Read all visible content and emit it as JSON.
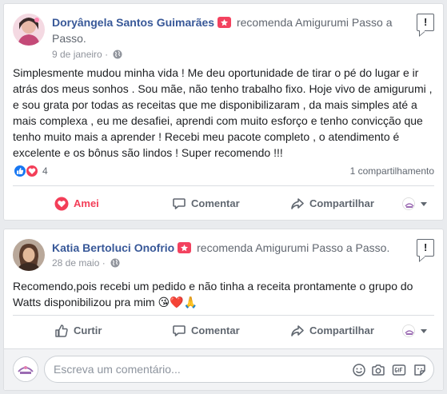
{
  "colors": {
    "link": "#385898",
    "love": "#f33e58",
    "recommend": "#f3425f",
    "muted": "#606770"
  },
  "posts": [
    {
      "author": "Doryângela Santos Guimarães",
      "verb": "recomenda Amigurumi Passo a",
      "verb_cont": "Passo.",
      "date": "9 de janeiro",
      "dot": "·",
      "text": "Simplesmente mudou minha vida ! Me deu oportunidade de tirar o pé do lugar e ir atrás dos meus sonhos . Sou mãe, não tenho trabalho fixo. Hoje vivo de amigurumi , e sou grata por todas as receitas que me disponibilizaram , da mais simples até a mais complexa , eu me desafiei, aprendi com muito esforço e tenho convicção que tenho muito mais a aprender ! Recebi meu pacote completo , o atendimento é excelente e os bônus são lindos ! Super recomendo !!!",
      "reaction_count": "4",
      "shares": "1 compartilhamento",
      "like_label": "Amei",
      "comment_label": "Comentar",
      "share_label": "Compartilhar",
      "flag": "!"
    },
    {
      "author": "Katia Bertoluci Onofrio",
      "verb": "recomenda Amigurumi Passo a Passo.",
      "date": "28 de maio",
      "dot": "·",
      "text": "Recomendo,pois recebi um pedido e não tinha a receita prontamente o grupo do Watts disponibilizou pra mim",
      "emoji": "😘❤️🙏",
      "like_label": "Curtir",
      "comment_label": "Comentar",
      "share_label": "Compartilhar",
      "flag": "!"
    }
  ],
  "comment_box": {
    "placeholder": "Escreva um comentário..."
  },
  "icons": [
    "recommend-icon",
    "globe-icon",
    "flag-icon",
    "like-reaction-icon",
    "love-reaction-icon",
    "heart-icon",
    "comment-icon",
    "share-icon",
    "thumbs-up-icon",
    "emoji-icon",
    "camera-icon",
    "gif-icon",
    "sticker-icon",
    "chevron-down-icon"
  ]
}
